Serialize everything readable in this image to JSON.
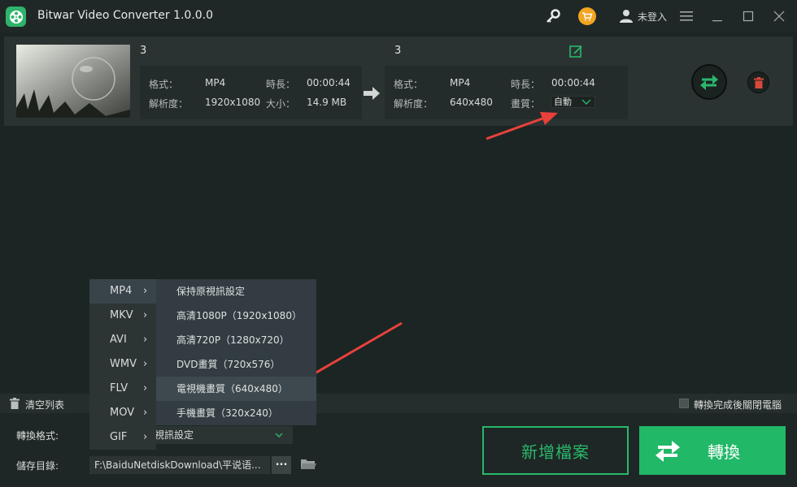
{
  "window": {
    "title": "Bitwar Video Converter  1.0.0.0",
    "login_label": "未登入"
  },
  "file": {
    "source_name": "3",
    "target_name": "3",
    "source": {
      "format_label": "格式：",
      "format": "MP4",
      "duration_label": "時長：",
      "duration": "00:00:44",
      "resolution_label": "解析度：",
      "resolution": "1920x1080",
      "size_label": "大小：",
      "size": "14.9 MB"
    },
    "target": {
      "format_label": "格式：",
      "format": "MP4",
      "duration_label": "時長：",
      "duration": "00:00:44",
      "resolution_label": "解析度：",
      "resolution": "640x480",
      "quality_label": "畫質：",
      "quality": "自動"
    }
  },
  "bottom_bar": {
    "clear_list": "清空列表",
    "shutdown_label": "轉換完成後關閉電腦"
  },
  "settings": {
    "format_label": "轉換格式:",
    "format_value": "視訊設定",
    "output_label": "儲存目錄:",
    "output_path": "F:\\BaiduNetdiskDownload\\平说语...",
    "browse": "..."
  },
  "buttons": {
    "add_files": "新增檔案",
    "convert": "轉換"
  },
  "format_menu": {
    "items": [
      {
        "label": "MP4",
        "chevron": "›"
      },
      {
        "label": "MKV",
        "chevron": "›"
      },
      {
        "label": "AVI",
        "chevron": "›"
      },
      {
        "label": "WMV",
        "chevron": "›"
      },
      {
        "label": "FLV",
        "chevron": "›"
      },
      {
        "label": "MOV",
        "chevron": "›"
      },
      {
        "label": "GIF",
        "chevron": "›"
      }
    ]
  },
  "quality_menu": {
    "items": [
      {
        "label": "保持原視訊設定"
      },
      {
        "label": "高清1080P（1920x1080）"
      },
      {
        "label": "高清720P（1280x720）"
      },
      {
        "label": "DVD畫質（720x576）"
      },
      {
        "label": "電視機畫質（640x480）"
      },
      {
        "label": "手機畫質（320x240）"
      }
    ]
  },
  "colors": {
    "accent_green": "#21b868",
    "annotation_red": "#e8413c",
    "cart_orange": "#f3a521",
    "delete_red": "#d9483b"
  },
  "icons": {
    "app_logo": "film-reel-icon",
    "key": "key-icon",
    "cart": "cart-icon",
    "user": "user-icon",
    "menu": "hamburger-menu-icon",
    "minimize": "minimize-icon",
    "maximize": "maximize-icon",
    "close": "close-icon",
    "edit": "edit-icon",
    "arrow": "arrow-right-icon",
    "convert": "convert-arrows-icon",
    "delete": "trash-icon",
    "clear": "trash-icon",
    "folder": "folder-icon",
    "chevron": "chevron-down-icon"
  }
}
